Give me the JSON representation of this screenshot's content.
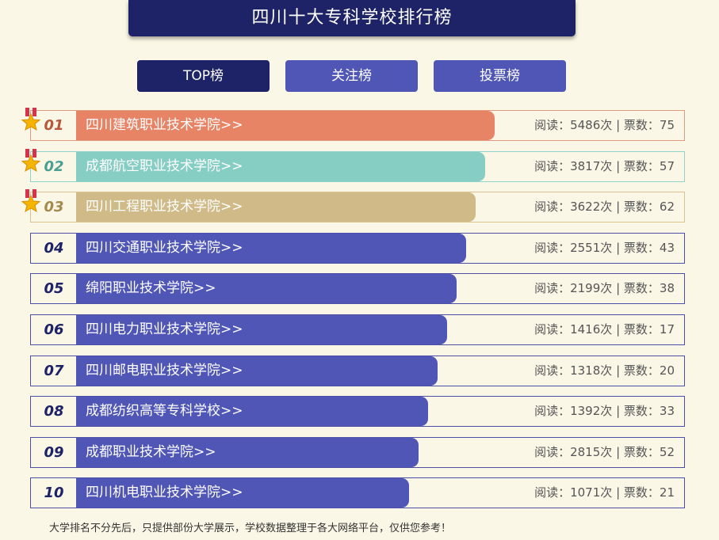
{
  "header": {
    "title": "四川十大专科学校排行榜"
  },
  "tabs": [
    {
      "label": "TOP榜",
      "active": true
    },
    {
      "label": "关注榜",
      "active": false
    },
    {
      "label": "投票榜",
      "active": false
    }
  ],
  "labels": {
    "read": "阅读：",
    "read_unit": "次",
    "sep": " | ",
    "votes": "票数："
  },
  "colors": {
    "first": "#e88466",
    "second": "#86cdc4",
    "third": "#d0bb88",
    "default": "#4f56b5",
    "first_border": "#e09a82",
    "second_border": "#8fd4c9",
    "third_border": "#d8c28f",
    "first_text": "#b5583c",
    "second_text": "#4a9e92",
    "third_text": "#a48a4c"
  },
  "items": [
    {
      "rank": "01",
      "name": "四川建筑职业技术学院>>",
      "reads": "5486",
      "votes": "75",
      "medal": true
    },
    {
      "rank": "02",
      "name": "成都航空职业技术学院>>",
      "reads": "3817",
      "votes": "57",
      "medal": true
    },
    {
      "rank": "03",
      "name": "四川工程职业技术学院>>",
      "reads": "3622",
      "votes": "62",
      "medal": true
    },
    {
      "rank": "04",
      "name": "四川交通职业技术学院>>",
      "reads": "2551",
      "votes": "43",
      "medal": false
    },
    {
      "rank": "05",
      "name": "绵阳职业技术学院>>",
      "reads": "2199",
      "votes": "38",
      "medal": false
    },
    {
      "rank": "06",
      "name": "四川电力职业技术学院>>",
      "reads": "1416",
      "votes": "17",
      "medal": false
    },
    {
      "rank": "07",
      "name": "四川邮电职业技术学院>>",
      "reads": "1318",
      "votes": "20",
      "medal": false
    },
    {
      "rank": "08",
      "name": "成都纺织高等专科学校>>",
      "reads": "1392",
      "votes": "33",
      "medal": false
    },
    {
      "rank": "09",
      "name": "成都职业技术学院>>",
      "reads": "2815",
      "votes": "52",
      "medal": false
    },
    {
      "rank": "10",
      "name": "四川机电职业技术学院>>",
      "reads": "1071",
      "votes": "21",
      "medal": false
    }
  ],
  "footer": {
    "note": "大学排名不分先后，只提供部份大学展示，学校数据整理于各大网络平台，仅供您参考！"
  }
}
